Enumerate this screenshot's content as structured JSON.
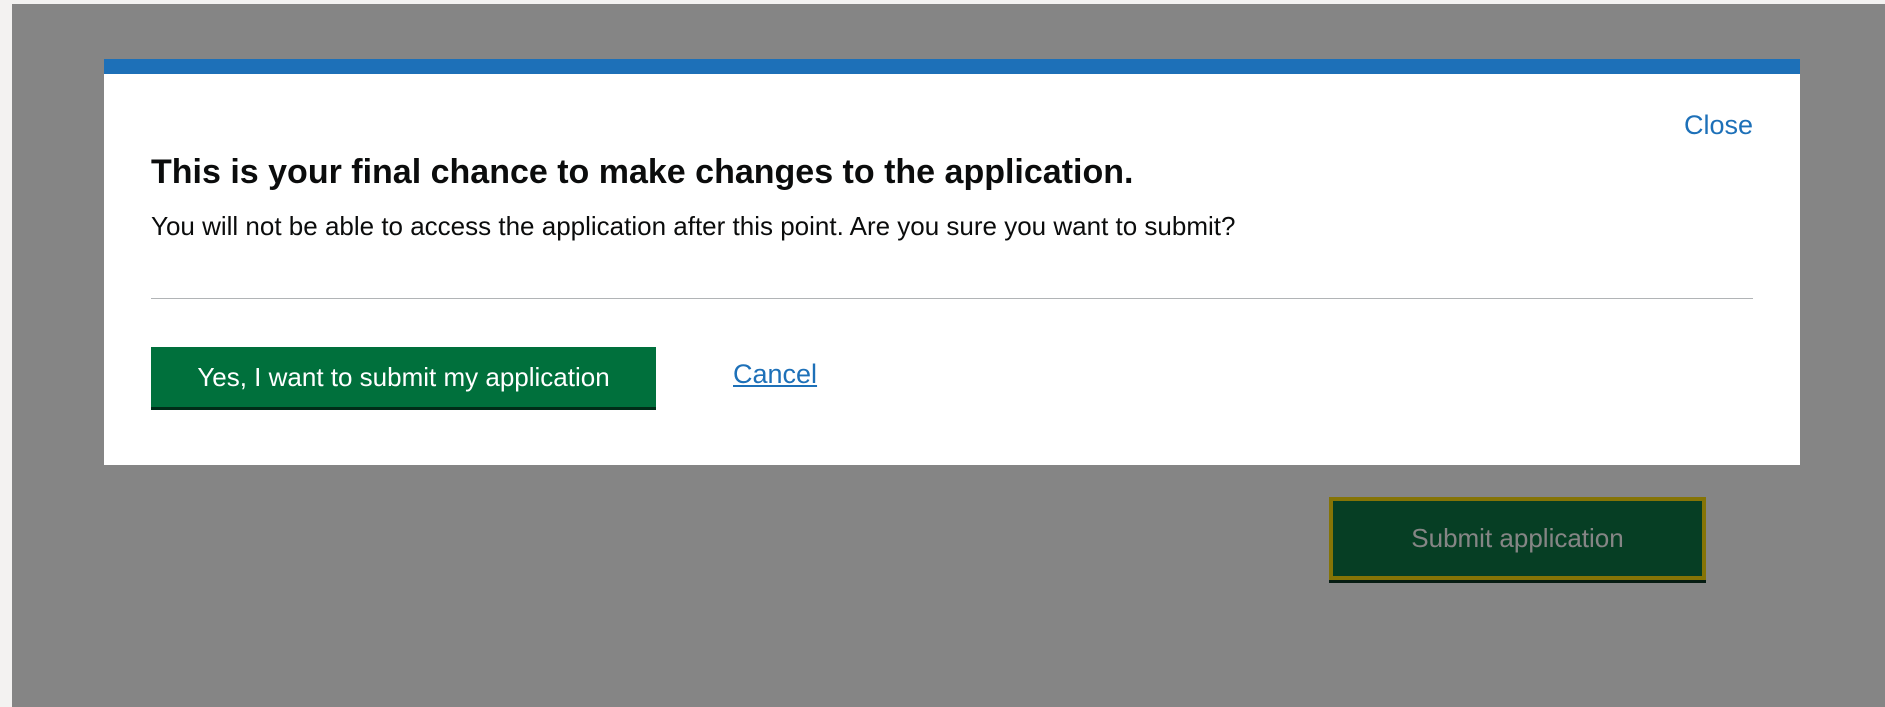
{
  "page": {
    "submit_button_label": "Submit application"
  },
  "dialog": {
    "close_label": "Close",
    "title": "This is your final chance to make changes to the application.",
    "body": "You will not be able to access the application after this point. Are you sure you want to submit?",
    "confirm_label": "Yes, I want to submit my application",
    "cancel_label": "Cancel"
  },
  "colors": {
    "accent_blue": "#1d70b8",
    "primary_green": "#00703c",
    "focus_yellow": "#ffdd00",
    "overlay": "rgba(11,12,12,0.5)"
  }
}
